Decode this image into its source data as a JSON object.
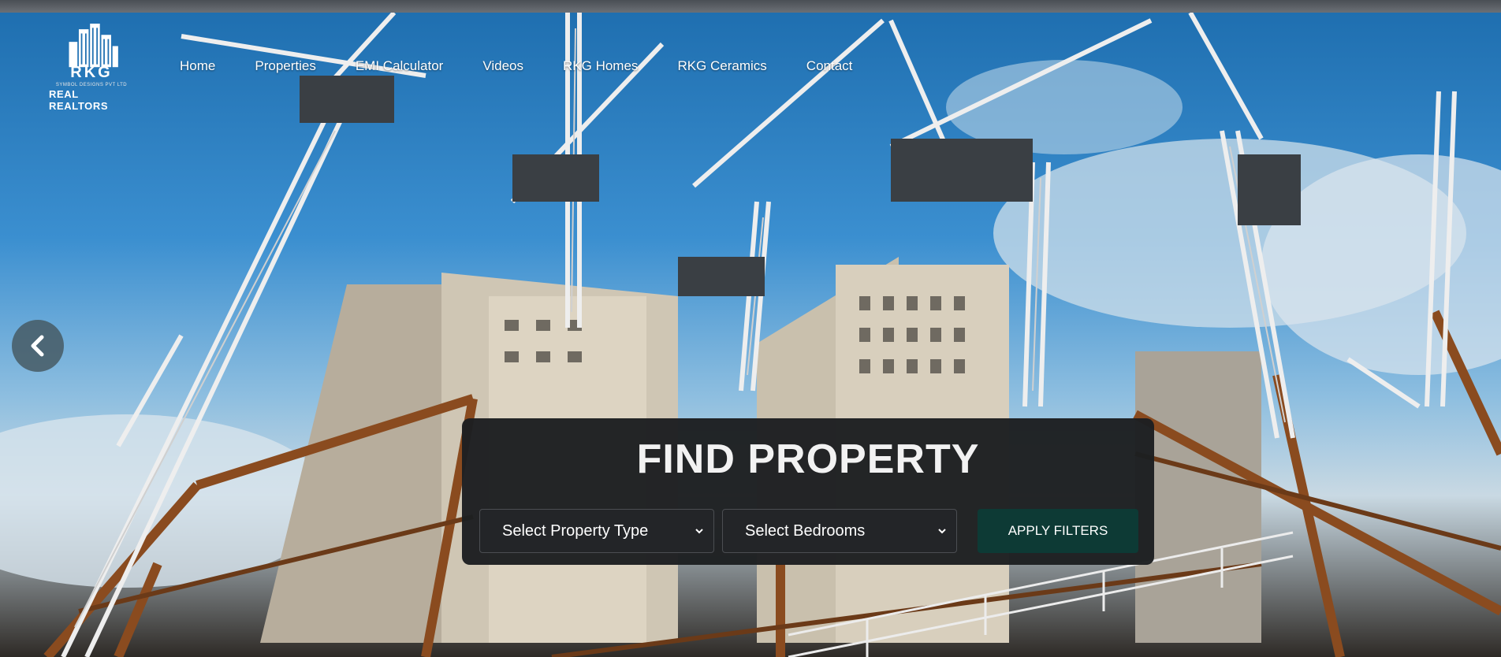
{
  "logo": {
    "brand": "RKG",
    "tiny": "SYMBOL DESIGNS PVT LTD",
    "name": "REAL REALTORS"
  },
  "nav": {
    "items": [
      {
        "label": "Home"
      },
      {
        "label": "Properties"
      },
      {
        "label": "EMI Calculator"
      },
      {
        "label": "Videos"
      },
      {
        "label": "RKG Homes"
      },
      {
        "label": "RKG Ceramics"
      },
      {
        "label": "Contact"
      }
    ]
  },
  "hero": {
    "prev_icon": "chevron-left-icon"
  },
  "search": {
    "title": "FIND PROPERTY",
    "property_type": "Select Property Type",
    "bedrooms": "Select Bedrooms",
    "apply_label": "APPLY FILTERS"
  },
  "colors": {
    "panel": "#1d1f21",
    "apply_button": "#0d3a35",
    "nav_text": "#ffffff"
  }
}
